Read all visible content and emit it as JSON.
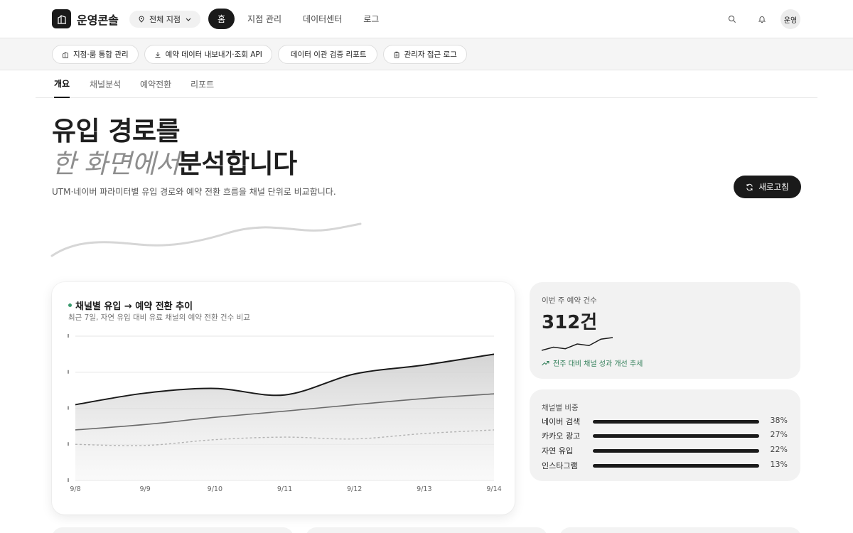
{
  "brand": {
    "name": "운영콘솔"
  },
  "branch": {
    "label": "전체 지점"
  },
  "nav": [
    "홈",
    "지점 관리",
    "데이터센터",
    "로그"
  ],
  "user": {
    "avatar_label": "운영"
  },
  "quick_actions": [
    "지점·룸 통합 관리",
    "예약 데이터 내보내기·조회 API",
    "데이터 이관 검증 리포트",
    "관리자 접근 로그"
  ],
  "tabs": [
    "개요",
    "채널분석",
    "예약전환",
    "리포트"
  ],
  "hero": {
    "line1": "유입 경로를",
    "line2_italic": "한 화면에서",
    "line2_bold": "분석합니다",
    "subtitle": "UTM·네이버 파라미터별 유입 경로와 예약 전환 흐름을 채널 단위로 비교합니다.",
    "refresh_label": "새로고침"
  },
  "colors": {
    "accent_dark": "#1a1a1a",
    "trend_green": "#2f7d57",
    "dot_green": "#3a9a6e"
  },
  "chart_data": {
    "type": "area",
    "title": "채널별 유입 → 예약 전환 추이",
    "subtitle": "최근 7일, 자연 유입 대비 유료 채널의 예약 전환 건수 비교",
    "categories": [
      "9/8",
      "9/9",
      "9/10",
      "9/11",
      "9/12",
      "9/13",
      "9/14"
    ],
    "ylim": [
      0,
      4
    ],
    "grid": true,
    "series": [
      {
        "values": [
          2.1,
          2.42,
          2.55,
          2.37,
          2.95,
          3.2,
          3.5
        ]
      },
      {
        "values": [
          1.4,
          1.55,
          1.75,
          1.92,
          2.1,
          2.27,
          2.4
        ]
      },
      {
        "values": [
          1.0,
          0.97,
          1.13,
          1.2,
          1.15,
          1.3,
          1.4
        ]
      }
    ]
  },
  "kpi": {
    "label": "이번 주 예약 건수",
    "value": "312건",
    "trend_text": "전주 대비 채널 성과 개선 추세",
    "spark": [
      2,
      4,
      3,
      6,
      5,
      9,
      10
    ]
  },
  "share": {
    "title": "채널별 비중",
    "items": [
      {
        "name": "네이버 검색",
        "pct": "38%"
      },
      {
        "name": "카카오 광고",
        "pct": "27%"
      },
      {
        "name": "자연 유입",
        "pct": "22%"
      },
      {
        "name": "인스타그램",
        "pct": "13%"
      }
    ]
  },
  "icons": [
    "building-icon",
    "pin-icon",
    "chevron-down-icon",
    "search-icon",
    "bell-icon",
    "download-icon",
    "clipboard-icon",
    "refresh-icon",
    "trend-up-icon"
  ]
}
